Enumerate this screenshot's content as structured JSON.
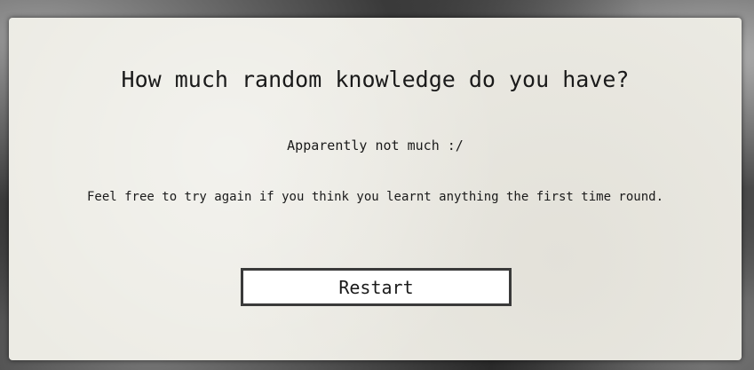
{
  "quiz": {
    "title": "How much random knowledge do you have?",
    "result": "Apparently not much :/",
    "message": "Feel free to try again if you think you learnt anything the first time round.",
    "restart_label": "Restart"
  }
}
